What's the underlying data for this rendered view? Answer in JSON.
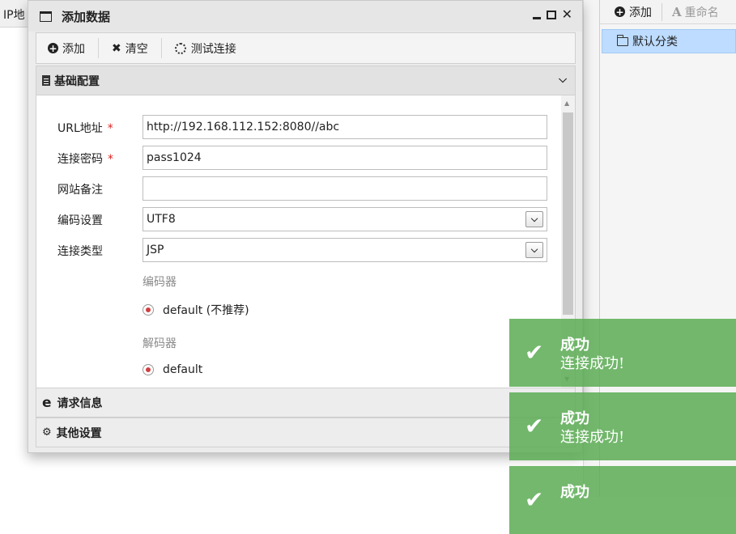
{
  "background": {
    "left_header": "IP地",
    "right_toolbar": {
      "add": "添加",
      "rename": "重命名"
    },
    "category": "默认分类"
  },
  "dialog": {
    "title": "添加数据",
    "toolbar": {
      "add": "添加",
      "clear": "清空",
      "test_connection": "测试连接"
    },
    "sections": {
      "basic": "基础配置",
      "request": "请求信息",
      "other": "其他设置"
    },
    "form": {
      "url_label": "URL地址",
      "url_value": "http://192.168.112.152:8080//abc",
      "password_label": "连接密码",
      "password_value": "pass1024",
      "note_label": "网站备注",
      "note_value": "",
      "encoding_label": "编码设置",
      "encoding_value": "UTF8",
      "type_label": "连接类型",
      "type_value": "JSP",
      "encoder_label": "编码器",
      "encoder_option": "default (不推荐)",
      "decoder_label": "解码器",
      "decoder_option": "default",
      "required_mark": "*"
    }
  },
  "toasts": [
    {
      "title": "成功",
      "message": "连接成功!"
    },
    {
      "title": "成功",
      "message": "连接成功!"
    },
    {
      "title": "成功",
      "message": ""
    }
  ],
  "colors": {
    "toast_bg": "#5cac55",
    "selected_tree": "#bddcff",
    "required": "#e02020"
  }
}
